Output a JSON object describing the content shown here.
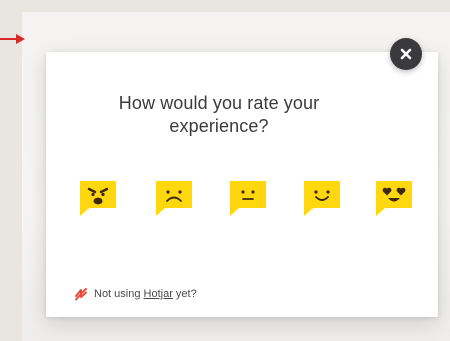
{
  "survey": {
    "question_line1": "How would you rate your",
    "question_line2": "experience?",
    "ratings": [
      {
        "icon": "angry-face-icon"
      },
      {
        "icon": "sad-face-icon"
      },
      {
        "icon": "neutral-face-icon"
      },
      {
        "icon": "happy-face-icon"
      },
      {
        "icon": "heart-eyes-face-icon"
      }
    ],
    "close_icon": "close-icon"
  },
  "footer": {
    "prefix": "Not using ",
    "link_text": "Hotjar",
    "suffix": " yet?",
    "icon": "hotjar-logo-icon"
  },
  "colors": {
    "emoji_yellow": "#ffd70f",
    "face_dark": "#3a2a0a",
    "close_bg": "#3a3a3c",
    "hotjar_red": "#e94a3c",
    "arrow_red": "#d62a2a"
  }
}
